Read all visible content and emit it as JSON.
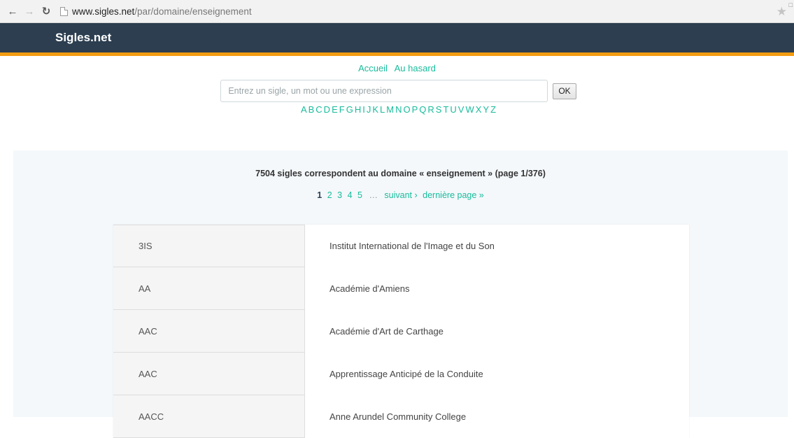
{
  "browser": {
    "url_host": "www.sigles.net",
    "url_path": "/par/domaine/enseignement"
  },
  "site": {
    "brand": "Sigles.net",
    "accent_color": "#f39c12",
    "header_color": "#2c3e50",
    "link_color": "#18bc9c"
  },
  "nav": {
    "home": "Accueil",
    "random": "Au hasard"
  },
  "search": {
    "placeholder": "Entrez un sigle, un mot ou une expression",
    "button": "OK"
  },
  "alphabet": [
    "A",
    "B",
    "C",
    "D",
    "E",
    "F",
    "G",
    "H",
    "I",
    "J",
    "K",
    "L",
    "M",
    "N",
    "O",
    "P",
    "Q",
    "R",
    "S",
    "T",
    "U",
    "V",
    "W",
    "X",
    "Y",
    "Z"
  ],
  "results": {
    "title": "7504 sigles correspondent au domaine « enseignement » (page 1/376)",
    "pagination": {
      "current": "1",
      "pages": [
        "2",
        "3",
        "4",
        "5"
      ],
      "ellipsis": "…",
      "next": "suivant ›",
      "last": "dernière page »"
    },
    "rows": [
      {
        "sigle": "3IS",
        "definition": "Institut International de l'Image et du Son"
      },
      {
        "sigle": "AA",
        "definition": "Académie d'Amiens"
      },
      {
        "sigle": "AAC",
        "definition": "Académie d'Art de Carthage"
      },
      {
        "sigle": "AAC",
        "definition": "Apprentissage Anticipé de la Conduite"
      },
      {
        "sigle": "AACC",
        "definition": "Anne Arundel Community College"
      }
    ]
  }
}
